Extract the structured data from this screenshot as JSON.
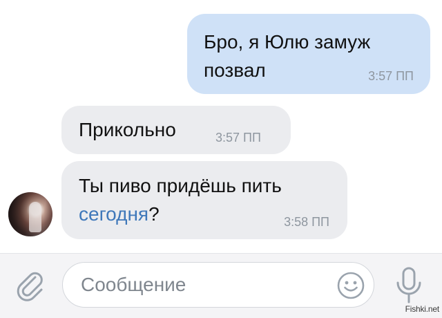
{
  "chat": {
    "messages": [
      {
        "direction": "outgoing",
        "line1": "Бро, я Юлю замуж",
        "line2": "позвал",
        "time": "3:57 ПП"
      },
      {
        "direction": "incoming",
        "line1": "Прикольно",
        "time": "3:57 ПП"
      },
      {
        "direction": "incoming",
        "line1": "Ты пиво придёшь пить",
        "line2_link": "сегодня",
        "line2_rest": "?",
        "time": "3:58 ПП"
      }
    ],
    "avatar": {
      "icon": "user-avatar-photo"
    }
  },
  "composer": {
    "placeholder": "Сообщение",
    "icons": {
      "attach": "paperclip-icon",
      "emoji": "smiley-icon",
      "voice": "microphone-icon"
    }
  },
  "watermark": "Fishki.net",
  "colors": {
    "outgoing_bubble": "#cfe1f7",
    "incoming_bubble": "#ebecef",
    "link": "#3f78ba",
    "timestamp": "#8e969f",
    "icon": "#9aa3ad"
  }
}
